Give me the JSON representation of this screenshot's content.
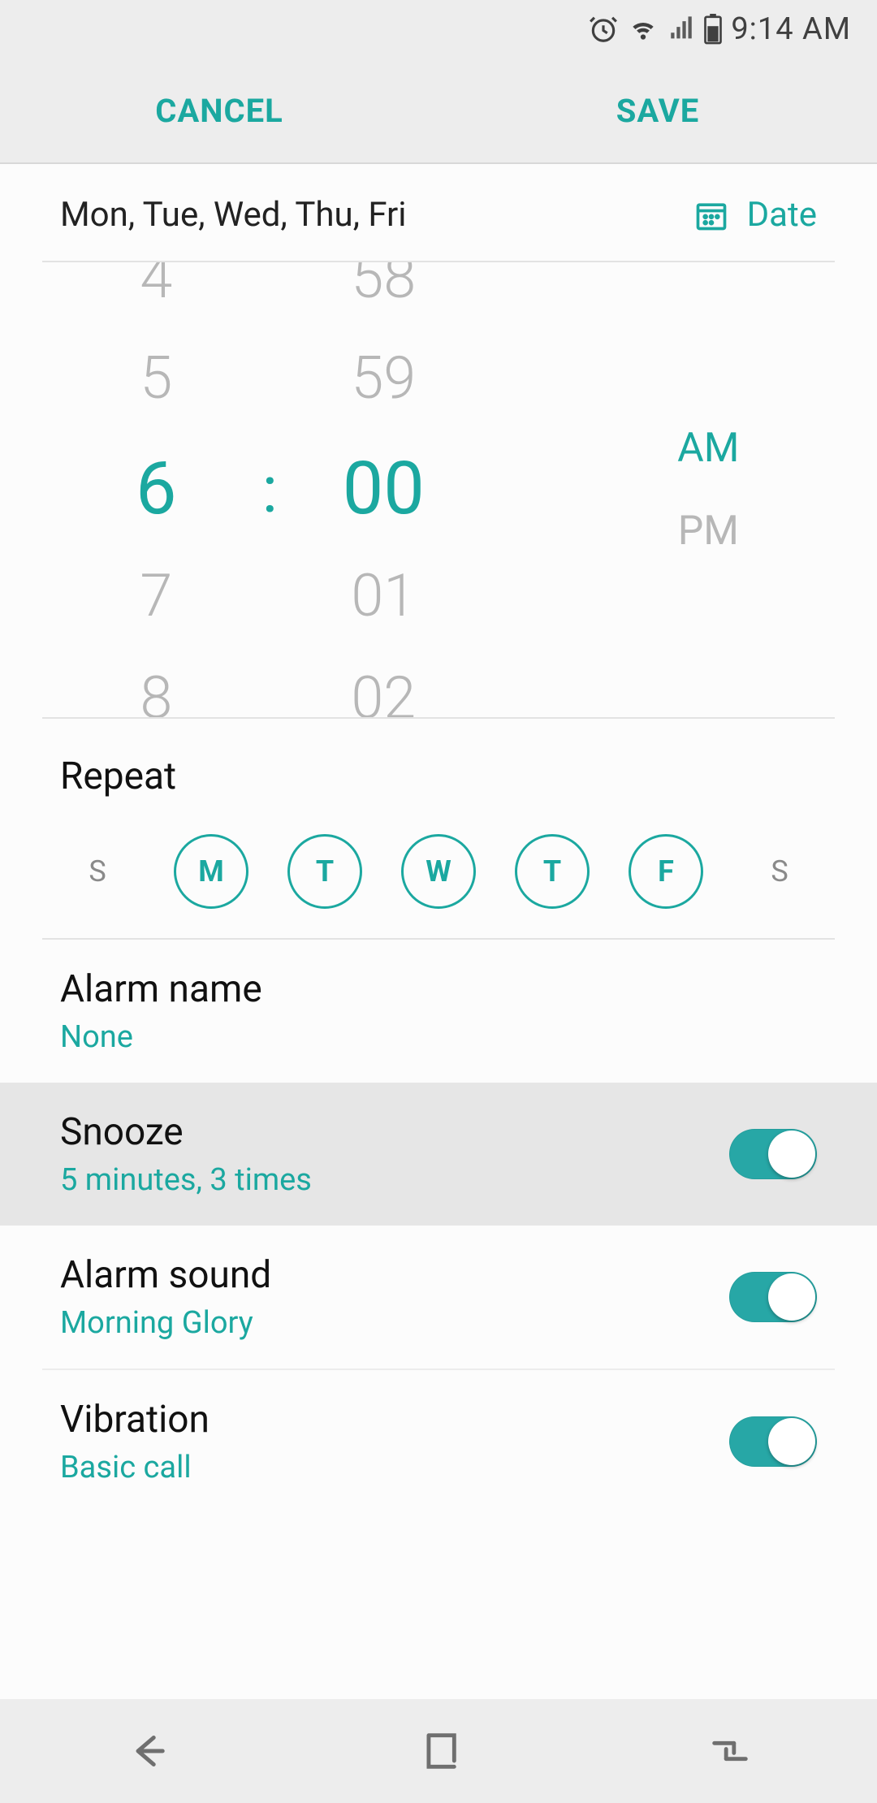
{
  "status": {
    "time": "9:14 AM"
  },
  "actions": {
    "cancel": "CANCEL",
    "save": "SAVE"
  },
  "selected_days_text": "Mon, Tue, Wed, Thu, Fri",
  "date_link": "Date",
  "time_picker": {
    "hours": [
      "4",
      "5",
      "6",
      "7",
      "8"
    ],
    "minutes": [
      "58",
      "59",
      "00",
      "01",
      "02"
    ],
    "selected_hour": "6",
    "selected_minute": "00",
    "colon": ":",
    "am": "AM",
    "pm": "PM",
    "ampm_selected": "AM"
  },
  "repeat": {
    "title": "Repeat",
    "days": [
      {
        "label": "S",
        "on": false
      },
      {
        "label": "M",
        "on": true
      },
      {
        "label": "T",
        "on": true
      },
      {
        "label": "W",
        "on": true
      },
      {
        "label": "T",
        "on": true
      },
      {
        "label": "F",
        "on": true
      },
      {
        "label": "S",
        "on": false
      }
    ]
  },
  "options": {
    "alarm_name": {
      "title": "Alarm name",
      "sub": "None"
    },
    "snooze": {
      "title": "Snooze",
      "sub": "5 minutes, 3 times",
      "toggle": true
    },
    "alarm_sound": {
      "title": "Alarm sound",
      "sub": "Morning Glory",
      "toggle": true
    },
    "vibration": {
      "title": "Vibration",
      "sub": "Basic call",
      "toggle": true
    }
  }
}
